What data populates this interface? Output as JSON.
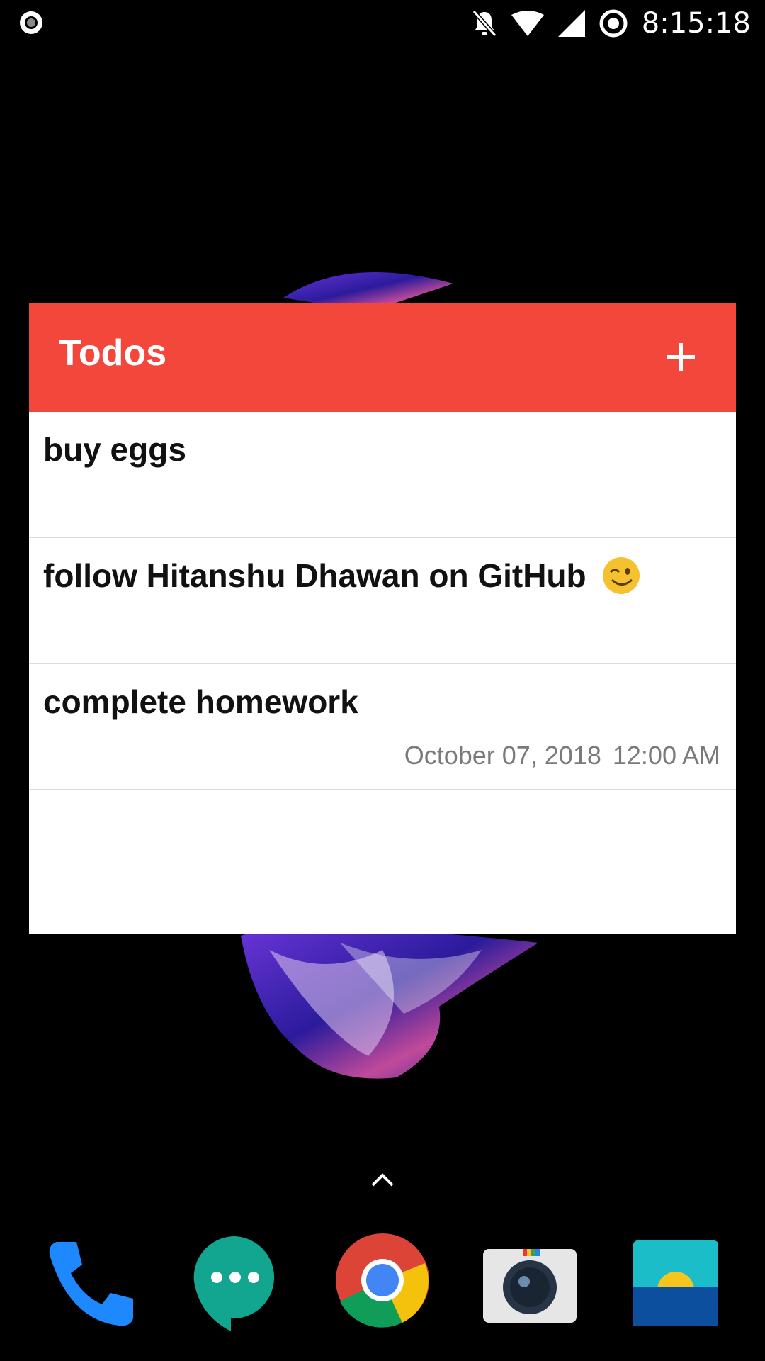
{
  "status_bar": {
    "time": "8:15:18",
    "icons": [
      "record-icon",
      "notifications-off-icon",
      "wifi-icon",
      "cell-signal-icon",
      "sync-icon"
    ]
  },
  "widget": {
    "title": "Todos",
    "add_icon": "plus-icon",
    "header_color": "#f4473c",
    "todos": [
      {
        "text": "buy eggs",
        "date": "",
        "time": ""
      },
      {
        "text": "follow Hitanshu Dhawan on GitHub",
        "emoji_icon": "wink-face-icon",
        "date": "",
        "time": ""
      },
      {
        "text": "complete homework",
        "date": "October 07, 2018",
        "time": "12:00 AM"
      }
    ]
  },
  "dock": {
    "apps": [
      "phone-icon",
      "hangouts-icon",
      "chrome-icon",
      "camera-icon",
      "gallery-icon"
    ]
  }
}
